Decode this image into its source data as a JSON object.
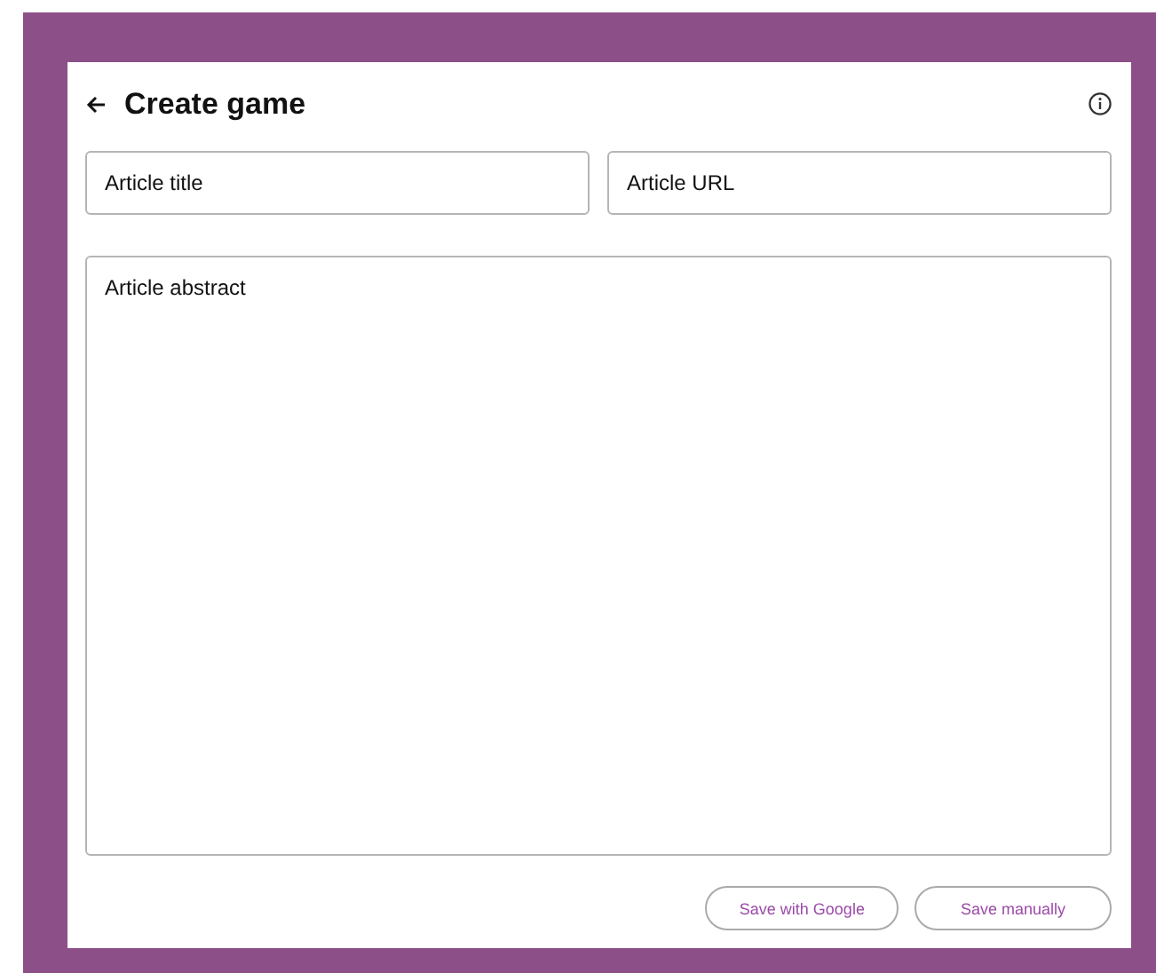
{
  "header": {
    "title": "Create game"
  },
  "fields": [
    {
      "placeholder": "Article title"
    },
    {
      "placeholder": "Article URL"
    }
  ],
  "abstract": {
    "placeholder": "Article abstract"
  },
  "buttons": [
    "Save with Google",
    "Save manually"
  ]
}
